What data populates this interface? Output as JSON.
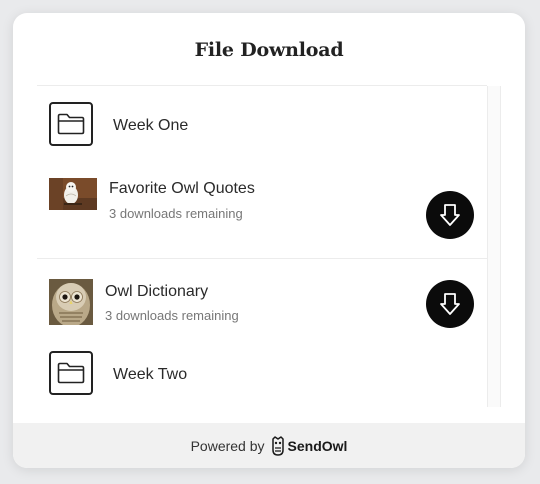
{
  "title": "File Download",
  "items": [
    {
      "type": "folder",
      "label": "Week One"
    },
    {
      "type": "file",
      "name": "Favorite Owl Quotes",
      "remaining": "3 downloads remaining",
      "icon": "download-icon"
    },
    {
      "type": "file",
      "name": "Owl Dictionary",
      "remaining": "3 downloads remaining",
      "icon": "download-icon"
    },
    {
      "type": "folder",
      "label": "Week Two"
    }
  ],
  "footer": {
    "powered_by": "Powered by",
    "brand_name": "SendOwl",
    "brand_icon": "owl-logo-icon"
  },
  "colors": {
    "button": "#0b0b0b",
    "footer_bg": "#f1f1f1",
    "page_bg": "#e9eaec"
  }
}
